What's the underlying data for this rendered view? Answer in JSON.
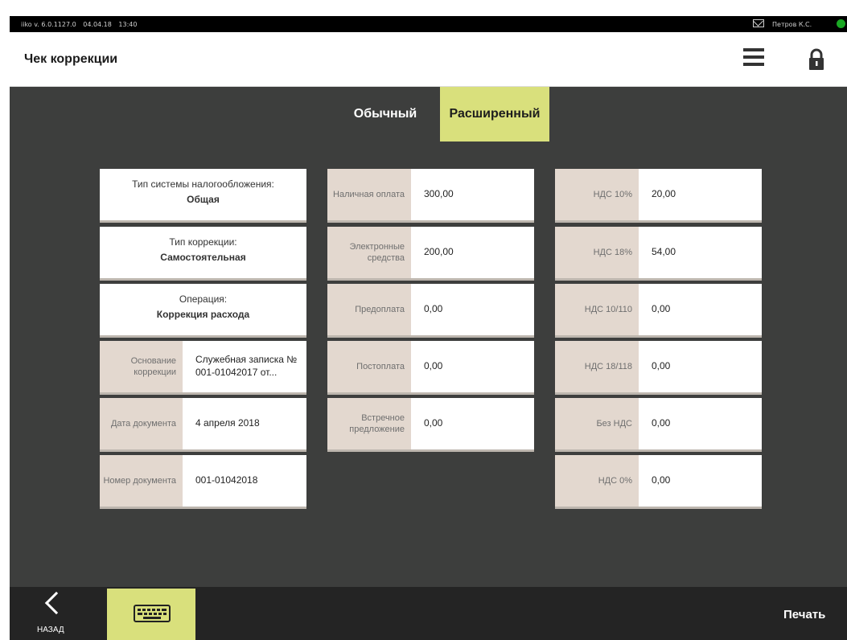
{
  "statusbar": {
    "version": "iiko v. 6.0.1127.0",
    "date": "04.04.18",
    "time": "13:40",
    "user": "Петров К.С."
  },
  "header": {
    "title": "Чек коррекции"
  },
  "tabs": [
    {
      "label": "Обычный"
    },
    {
      "label": "Расширенный"
    }
  ],
  "left": {
    "tax_system": {
      "label": "Тип системы налогообложения:",
      "value": "Общая"
    },
    "correction_type": {
      "label": "Тип коррекции:",
      "value": "Самостоятельная"
    },
    "operation": {
      "label": "Операция:",
      "value": "Коррекция расхода"
    },
    "reason": {
      "label": "Основание коррекции",
      "value": "Служебная записка № 001-01042017 от..."
    },
    "doc_date": {
      "label": "Дата документа",
      "value": "4 апреля 2018"
    },
    "doc_number": {
      "label": "Номер документа",
      "value": "001-01042018"
    }
  },
  "payments": [
    {
      "label": "Наличная оплата",
      "value": "300,00"
    },
    {
      "label": "Электронные средства",
      "value": "200,00"
    },
    {
      "label": "Предоплата",
      "value": "0,00"
    },
    {
      "label": "Постоплата",
      "value": "0,00"
    },
    {
      "label": "Встречное предложение",
      "value": "0,00"
    }
  ],
  "vat": [
    {
      "label": "НДС 10%",
      "value": "20,00"
    },
    {
      "label": "НДС 18%",
      "value": "54,00"
    },
    {
      "label": "НДС 10/110",
      "value": "0,00"
    },
    {
      "label": "НДС 18/118",
      "value": "0,00"
    },
    {
      "label": "Без НДС",
      "value": "0,00"
    },
    {
      "label": "НДС 0%",
      "value": "0,00"
    }
  ],
  "bottom": {
    "back_label": "НАЗАД",
    "print_label": "Печать"
  },
  "colors": {
    "accent": "#d9e07c",
    "label_bg": "#e3d8cf",
    "background": "#3d3e3d",
    "status_dot": "#1aa824"
  },
  "icons": {
    "menu": "hamburger-menu-icon",
    "lock": "lock-icon",
    "back": "chevron-left-icon",
    "keyboard": "keyboard-icon",
    "mail": "mail-icon"
  }
}
